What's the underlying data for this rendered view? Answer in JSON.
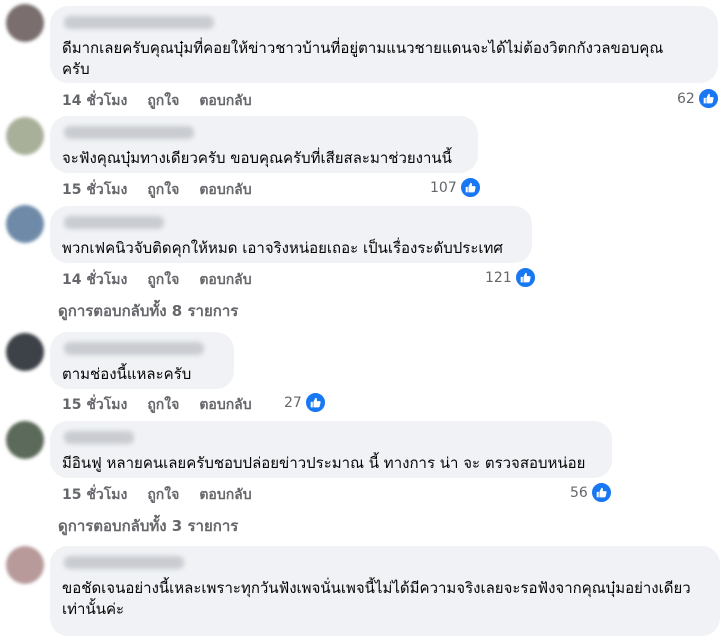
{
  "comments": [
    {
      "text": "ดีมากเลยครับคุณบุ๋มที่คอยให้ข่าวชาวบ้านที่อยู่ตามแนวชายแดนจะได้ไม่ต้องวิตกกังวลขอบคุณครับ",
      "time": "14 ชั่วโมง",
      "like": "ถูกใจ",
      "reply": "ตอบกลับ",
      "count": "62",
      "avatar_color": "#7a6e6e"
    },
    {
      "text": "จะฟังคุณบุ๋มทางเดียวครับ ขอบคุณครับที่เสียสละมาช่วยงานนี้",
      "time": "15 ชั่วโมง",
      "like": "ถูกใจ",
      "reply": "ตอบกลับ",
      "count": "107",
      "avatar_color": "#a9b09a"
    },
    {
      "text": "พวกเฟคนิวจับติดคุกให้หมด เอาจริงหน่อยเถอะ เป็นเรื่องระดับประเทศ",
      "time": "14 ชั่วโมง",
      "like": "ถูกใจ",
      "reply": "ตอบกลับ",
      "count": "121",
      "avatar_color": "#6f8aa8"
    },
    {
      "text": "ตามช่องนี้แหละครับ",
      "time": "15 ชั่วโมง",
      "like": "ถูกใจ",
      "reply": "ตอบกลับ",
      "count": "27",
      "avatar_color": "#3d4148"
    },
    {
      "text": "มีอินฟู หลายคนเลยครับชอบปล่อยข่าวประมาณ นี้ ทางการ น่า จะ ตรวจสอบหน่อย",
      "time": "15 ชั่วโมง",
      "like": "ถูกใจ",
      "reply": "ตอบกลับ",
      "count": "56",
      "avatar_color": "#5b6a5a"
    },
    {
      "text": "ขอชัดเจนอย่างนี้เหละเพราะทุกวันฟังเพจนั่นเพจนี้ไม่ได้มีความจริงเลยจะรอฟังจากคุณบุ๋มอย่างเดียวเท่านั้นค่ะ",
      "avatar_color": "#b89a9a"
    }
  ],
  "view_replies_1": "ดูการตอบกลับทั้ง 8 รายการ",
  "view_replies_2": "ดูการตอบกลับทั้ง 3 รายการ",
  "colors": {
    "accent": "#1877f2",
    "bubble": "#f0f2f5",
    "meta": "#65676b"
  },
  "icons": {
    "like": "thumbs-up-icon"
  }
}
